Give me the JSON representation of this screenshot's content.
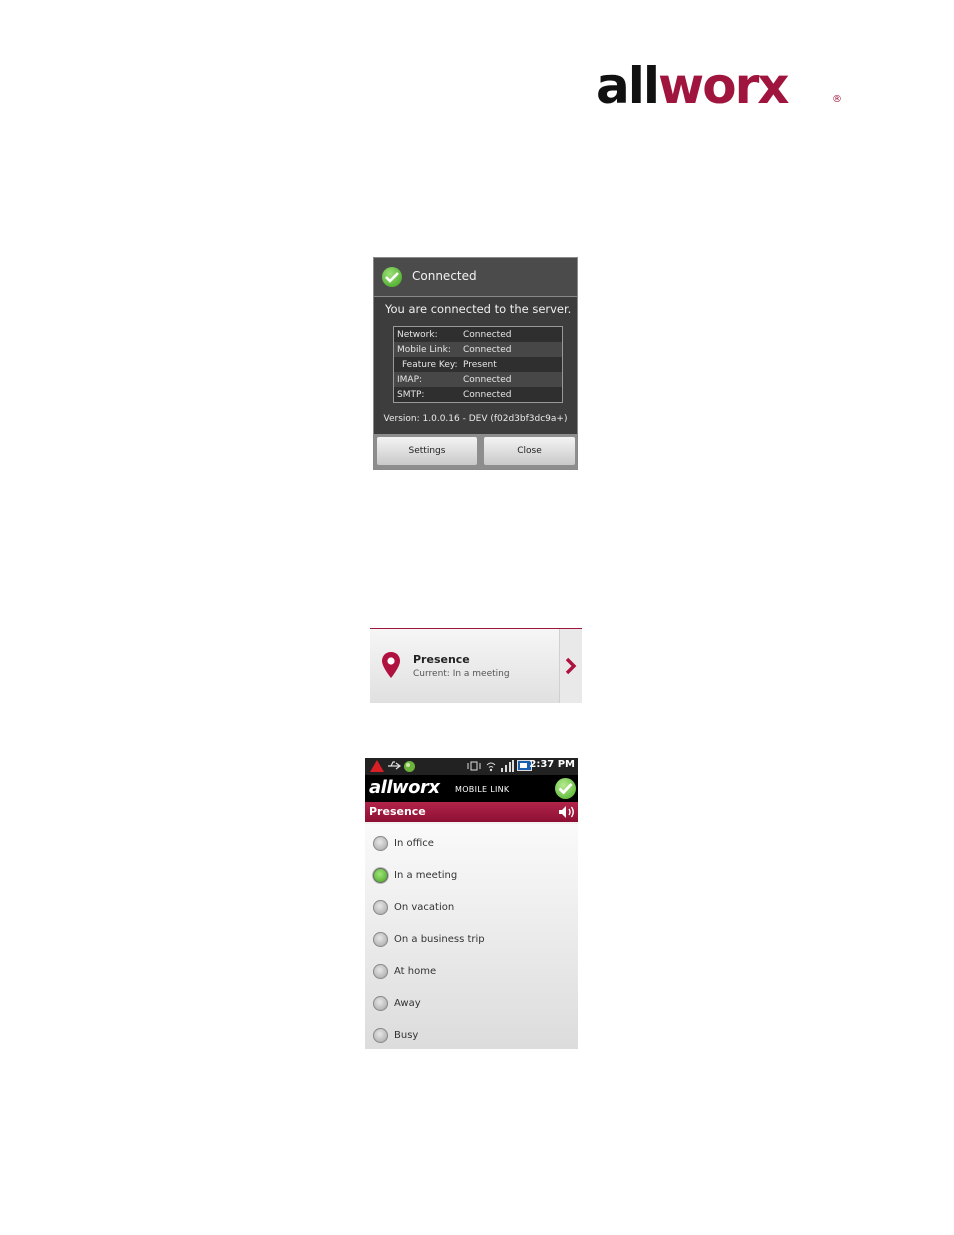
{
  "logo": {
    "text_dark": "all",
    "text_accent": "worx",
    "registered": "®"
  },
  "colors": {
    "brand": "#a0153e",
    "dialog_bg": "#3d3d3d",
    "ok_green": "#3aa11a"
  },
  "connected_dialog": {
    "title": "Connected",
    "message": "You are connected to the server.",
    "rows": [
      {
        "key": "Network:",
        "value": "Connected"
      },
      {
        "key": "Mobile Link:",
        "value": "Connected"
      },
      {
        "key": "Feature Key:",
        "value": "Present"
      },
      {
        "key": "IMAP:",
        "value": "Connected"
      },
      {
        "key": "SMTP:",
        "value": "Connected"
      }
    ],
    "version": "Version: 1.0.0.16 - DEV (f02d3bf3dc9a+)",
    "settings_label": "Settings",
    "close_label": "Close"
  },
  "presence_row": {
    "title": "Presence",
    "subtitle": "Current: In a meeting",
    "icon": "location-pin-icon"
  },
  "phone": {
    "status": {
      "time": "2:37 PM"
    },
    "brand": "allworx",
    "brand_suffix": "MOBILE LINK",
    "screen_title": "Presence",
    "options": [
      {
        "label": "In office",
        "selected": false
      },
      {
        "label": "In a meeting",
        "selected": true
      },
      {
        "label": "On vacation",
        "selected": false
      },
      {
        "label": "On a business trip",
        "selected": false
      },
      {
        "label": "At home",
        "selected": false
      },
      {
        "label": "Away",
        "selected": false
      },
      {
        "label": "Busy",
        "selected": false
      }
    ]
  }
}
